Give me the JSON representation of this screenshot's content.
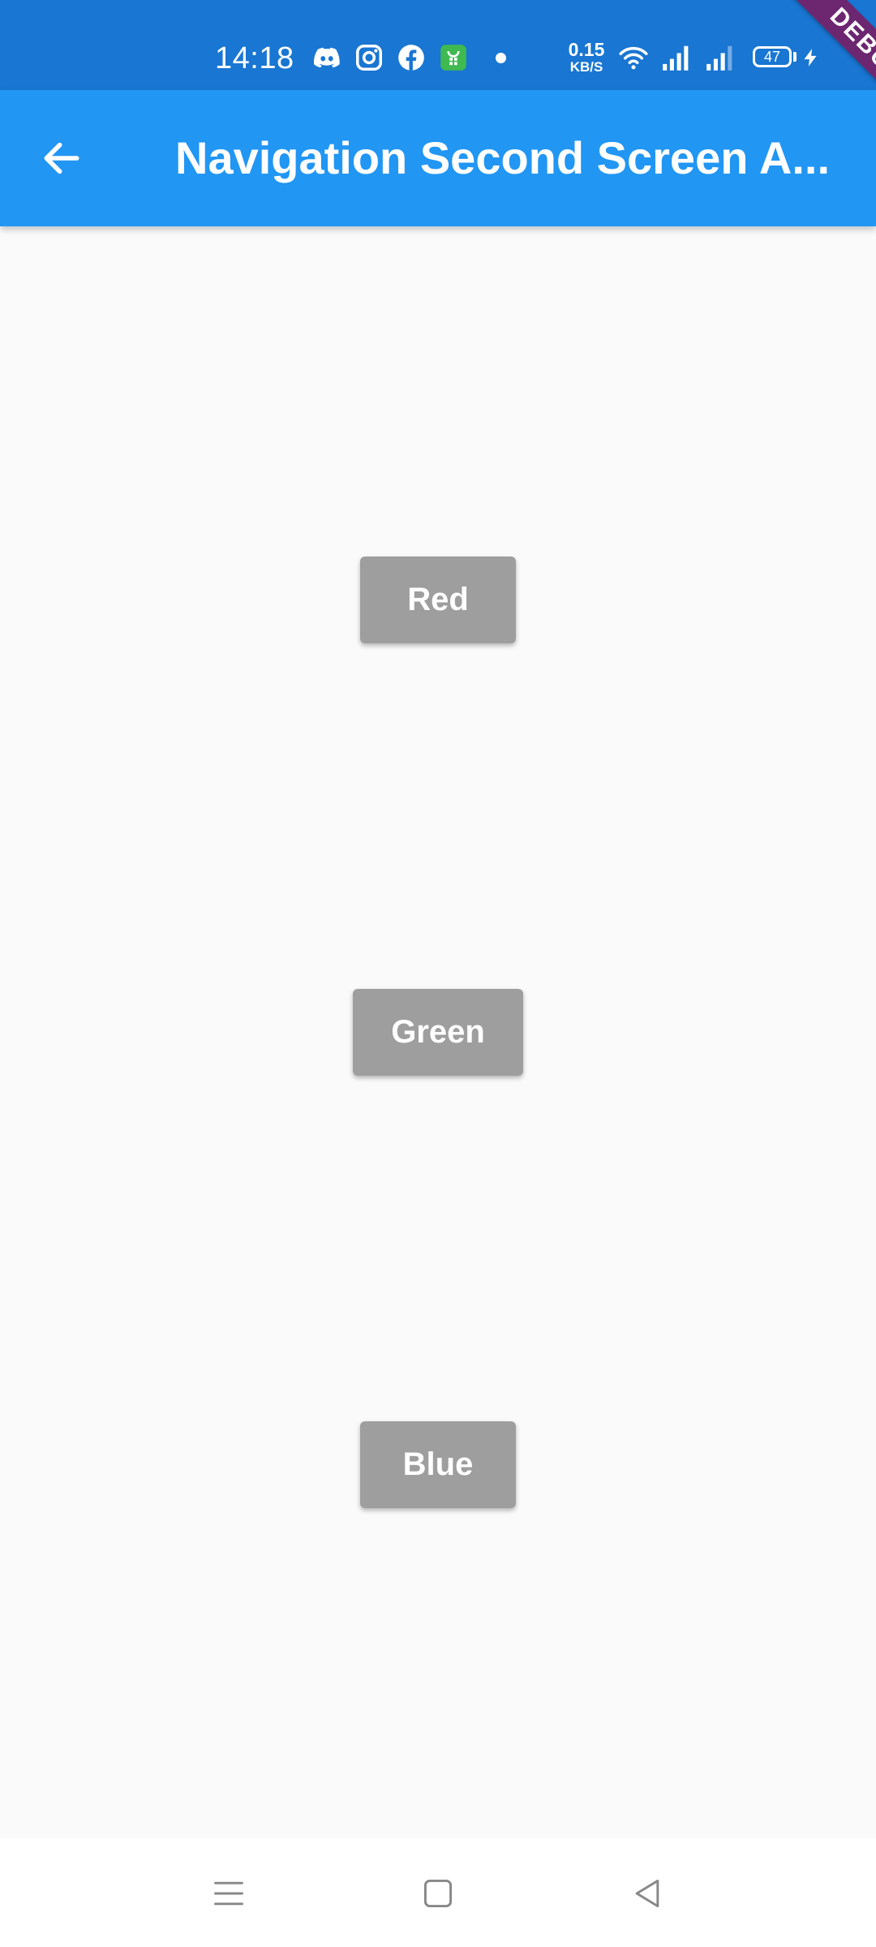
{
  "status_bar": {
    "time": "14:18",
    "icons": [
      "discord-icon",
      "instagram-icon",
      "facebook-icon",
      "store-icon",
      "notification-dot",
      "wifi-icon",
      "signal-icon",
      "signal-icon",
      "battery-icon",
      "charging-icon"
    ],
    "net_speed_value": "0.15",
    "net_speed_unit": "KB/S",
    "battery_level": "47"
  },
  "debug_banner": "DEBUG",
  "app_bar": {
    "title": "Navigation Second Screen A...",
    "back_icon": "arrow-back-icon"
  },
  "buttons": {
    "red": "Red",
    "green": "Green",
    "blue": "Blue"
  },
  "nav_bar": {
    "icons": [
      "menu-icon",
      "home-icon",
      "back-triangle-icon"
    ]
  },
  "colors": {
    "status_bar": "#1976d2",
    "app_bar": "#2196f3",
    "button": "#9e9e9e",
    "background": "#fafafa",
    "debug_banner": "#880e4f"
  }
}
